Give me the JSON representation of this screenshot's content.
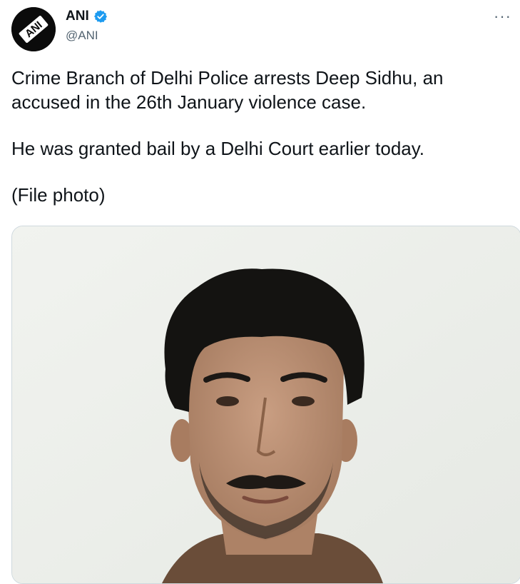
{
  "author": {
    "display_name": "ANI",
    "handle": "@ANI",
    "avatar_text": "ANI",
    "verified_icon": "verified-badge-icon"
  },
  "tweet": {
    "paragraphs": [
      "Crime Branch of Delhi Police arrests Deep Sidhu, an accused in the 26th January violence case.",
      "He was granted bail by a Delhi Court earlier today.",
      "(File photo)"
    ]
  },
  "more_menu": {
    "label": "···",
    "icon": "more-options-icon"
  },
  "media": {
    "type": "photo",
    "icon": "photo-of-man-icon"
  },
  "colors": {
    "text": "#0f1419",
    "secondary": "#536471",
    "verified": "#1d9bf0",
    "border": "#cfd9de"
  }
}
